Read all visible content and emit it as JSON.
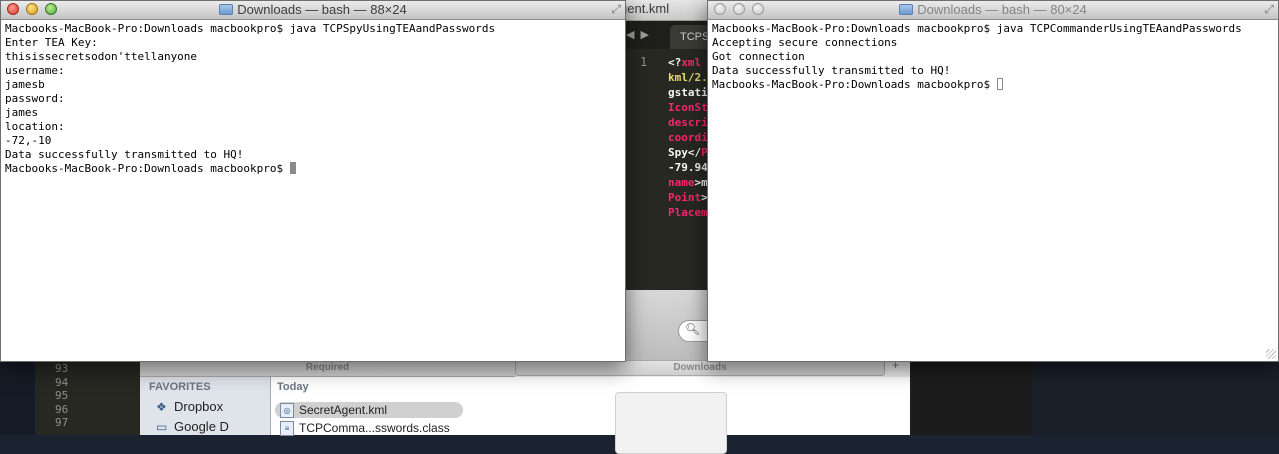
{
  "editor": {
    "title": "gent.kml",
    "tab_label": "TCPS",
    "line_number": "1",
    "code_lines": [
      {
        "parts": [
          {
            "t": "<?",
            "c": "white"
          },
          {
            "t": "xml ",
            "c": "pink"
          }
        ]
      },
      {
        "parts": [
          {
            "t": "kml/2.",
            "c": "yellow"
          }
        ]
      },
      {
        "parts": [
          {
            "t": "gstati",
            "c": "white"
          }
        ]
      },
      {
        "parts": [
          {
            "t": "IconSt",
            "c": "pink"
          }
        ]
      },
      {
        "parts": [
          {
            "t": "descri",
            "c": "pink"
          }
        ]
      },
      {
        "parts": [
          {
            "t": "coordi",
            "c": "pink"
          }
        ]
      },
      {
        "parts": [
          {
            "t": "Spy</",
            "c": "white"
          },
          {
            "t": "P",
            "c": "pink"
          }
        ]
      },
      {
        "parts": [
          {
            "t": "-79.94",
            "c": "white"
          }
        ]
      },
      {
        "parts": [
          {
            "t": "name",
            "c": "pink"
          },
          {
            "t": ">m",
            "c": "white"
          }
        ]
      },
      {
        "parts": [
          {
            "t": "Point",
            "c": "pink"
          },
          {
            "t": ">",
            "c": "white"
          }
        ]
      },
      {
        "parts": [
          {
            "t": "Placem",
            "c": "pink"
          }
        ]
      }
    ],
    "bottom_line_numbers": [
      "93",
      "94",
      "95",
      "96",
      "97"
    ]
  },
  "finder": {
    "pathbar_left": "Required",
    "pathbar_right": "Downloads",
    "sidebar_header": "FAVORITES",
    "sidebar_items": [
      "Dropbox",
      "Google D"
    ],
    "list_header": "Today",
    "files": [
      "SecretAgent.kml",
      "TCPComma...sswords.class"
    ]
  },
  "terminal_left": {
    "title": "Downloads — bash — 88×24",
    "lines": [
      "Macbooks-MacBook-Pro:Downloads macbookpro$ java TCPSpyUsingTEAandPasswords",
      "Enter TEA Key:",
      "thisissecretsodon'ttellanyone",
      "username:",
      "jamesb",
      "password:",
      "james",
      "location:",
      "-72,-10",
      "Data successfully transmitted to HQ!"
    ],
    "prompt": "Macbooks-MacBook-Pro:Downloads macbookpro$ "
  },
  "terminal_right": {
    "title": "Downloads — bash — 80×24",
    "lines": [
      "Macbooks-MacBook-Pro:Downloads macbookpro$ java TCPCommanderUsingTEAandPasswords",
      "Accepting secure connections",
      "Got connection",
      "Data successfully transmitted to HQ!"
    ],
    "prompt": "Macbooks-MacBook-Pro:Downloads macbookpro$ "
  }
}
